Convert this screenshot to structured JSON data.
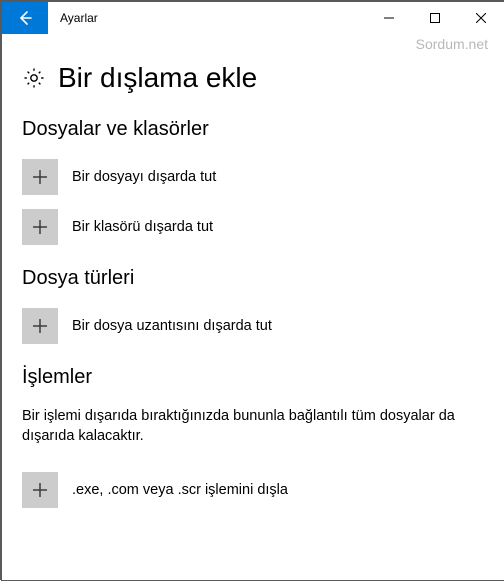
{
  "titlebar": {
    "app_title": "Ayarlar"
  },
  "watermark": "Sordum.net",
  "page": {
    "heading": "Bir dışlama ekle"
  },
  "sections": {
    "files_folders": {
      "title": "Dosyalar ve klasörler",
      "add_file_label": "Bir dosyayı dışarda tut",
      "add_folder_label": "Bir klasörü dışarda tut"
    },
    "file_types": {
      "title": "Dosya türleri",
      "add_ext_label": "Bir dosya uzantısını dışarda tut"
    },
    "processes": {
      "title": "İşlemler",
      "description": "Bir işlemi dışarıda bıraktığınızda bununla bağlantılı tüm dosyalar da dışarıda kalacaktır.",
      "add_process_label": ".exe, .com veya .scr işlemini dışla"
    }
  }
}
